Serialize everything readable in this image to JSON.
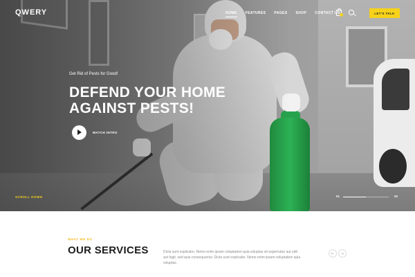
{
  "nav": {
    "logo": "QWERY",
    "menu": [
      {
        "label": "HOME",
        "active": true
      },
      {
        "label": "FEATURES",
        "active": false
      },
      {
        "label": "PAGES",
        "active": false
      },
      {
        "label": "SHOP",
        "active": false
      },
      {
        "label": "CONTACT US",
        "active": false
      }
    ],
    "cta_label": "LET'S TALK",
    "icons": {
      "cart": "shopping-bag-icon",
      "search": "search-icon"
    }
  },
  "hero": {
    "eyebrow": "Get Rid of Pests for Good!",
    "headline_line1": "DEFEND YOUR HOME",
    "headline_line2": "AGAINST PESTS!",
    "watch_label": "WATCH INTRO",
    "scroll_label": "SCROLL DOWN",
    "slider": {
      "current": "01",
      "total": "02",
      "progress": 0.5
    }
  },
  "services": {
    "eyebrow": "WHAT WE DO",
    "title": "OUR SERVICES",
    "description": "Dicta sunt explicabo. Nemo enim ipsam voluptatem quia voluptas sit aspernatur aut odit aut fugit, sed quia consequuntur. Dicta sunt explicabo. Nemo enim ipsam voluptatem quia voluptas.",
    "prev_arrow": "←",
    "next_arrow": "→"
  },
  "colors": {
    "accent": "#f6d21b",
    "dark": "#1c1c1c",
    "muted": "#8a8a8a"
  }
}
